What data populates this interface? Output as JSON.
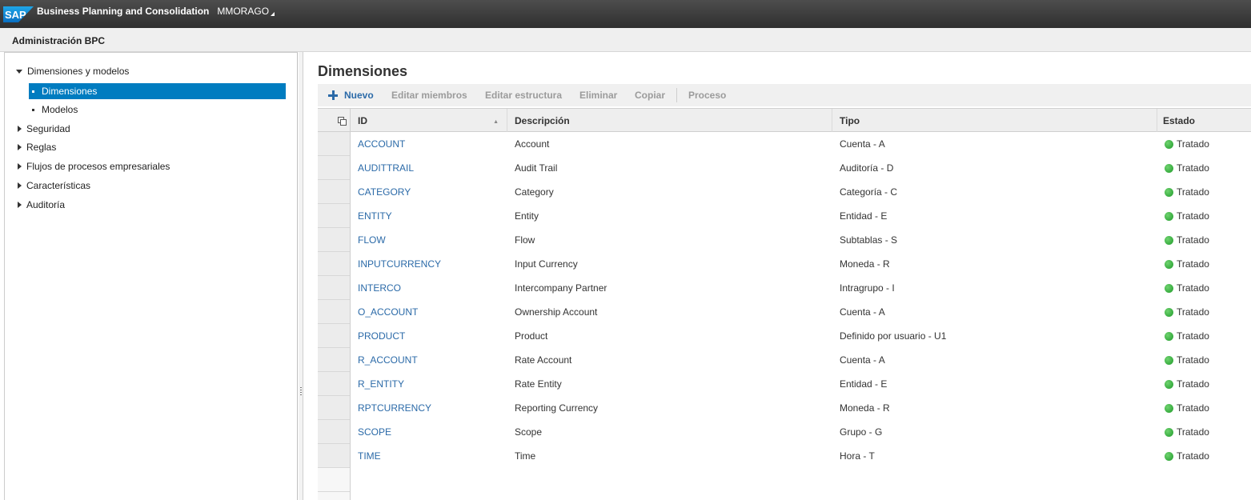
{
  "shell": {
    "logo_text": "SAP",
    "app_title": "Business Planning and Consolidation",
    "user": "MMORAGO"
  },
  "header": {
    "title": "Administración BPC"
  },
  "nav": {
    "items": [
      {
        "label": "Dimensiones y modelos",
        "expanded": true
      },
      {
        "label": "Dimensiones",
        "selected": true,
        "child": true
      },
      {
        "label": "Modelos",
        "child": true
      },
      {
        "label": "Seguridad"
      },
      {
        "label": "Reglas"
      },
      {
        "label": "Flujos de procesos empresariales"
      },
      {
        "label": "Características"
      },
      {
        "label": "Auditoría"
      }
    ]
  },
  "main": {
    "title": "Dimensiones",
    "toolbar": {
      "new": "Nuevo",
      "edit_members": "Editar miembros",
      "edit_structure": "Editar estructura",
      "delete": "Eliminar",
      "copy": "Copiar",
      "process": "Proceso"
    },
    "columns": {
      "id": "ID",
      "description": "Descripción",
      "type": "Tipo",
      "status": "Estado"
    },
    "rows": [
      {
        "id": "ACCOUNT",
        "description": "Account",
        "type": "Cuenta - A",
        "status": "Tratado"
      },
      {
        "id": "AUDITTRAIL",
        "description": "Audit Trail",
        "type": "Auditoría - D",
        "status": "Tratado"
      },
      {
        "id": "CATEGORY",
        "description": "Category",
        "type": "Categoría - C",
        "status": "Tratado"
      },
      {
        "id": "ENTITY",
        "description": "Entity",
        "type": "Entidad - E",
        "status": "Tratado"
      },
      {
        "id": "FLOW",
        "description": "Flow",
        "type": "Subtablas - S",
        "status": "Tratado"
      },
      {
        "id": "INPUTCURRENCY",
        "description": "Input Currency",
        "type": "Moneda - R",
        "status": "Tratado"
      },
      {
        "id": "INTERCO",
        "description": "Intercompany Partner",
        "type": "Intragrupo - I",
        "status": "Tratado"
      },
      {
        "id": "O_ACCOUNT",
        "description": "Ownership Account",
        "type": "Cuenta - A",
        "status": "Tratado"
      },
      {
        "id": "PRODUCT",
        "description": "Product",
        "type": "Definido por usuario - U1",
        "status": "Tratado"
      },
      {
        "id": "R_ACCOUNT",
        "description": "Rate Account",
        "type": "Cuenta - A",
        "status": "Tratado"
      },
      {
        "id": "R_ENTITY",
        "description": "Rate Entity",
        "type": "Entidad - E",
        "status": "Tratado"
      },
      {
        "id": "RPTCURRENCY",
        "description": "Reporting Currency",
        "type": "Moneda - R",
        "status": "Tratado"
      },
      {
        "id": "SCOPE",
        "description": "Scope",
        "type": "Grupo - G",
        "status": "Tratado"
      },
      {
        "id": "TIME",
        "description": "Time",
        "type": "Hora - T",
        "status": "Tratado"
      }
    ],
    "status_color": "#2aa83a"
  }
}
